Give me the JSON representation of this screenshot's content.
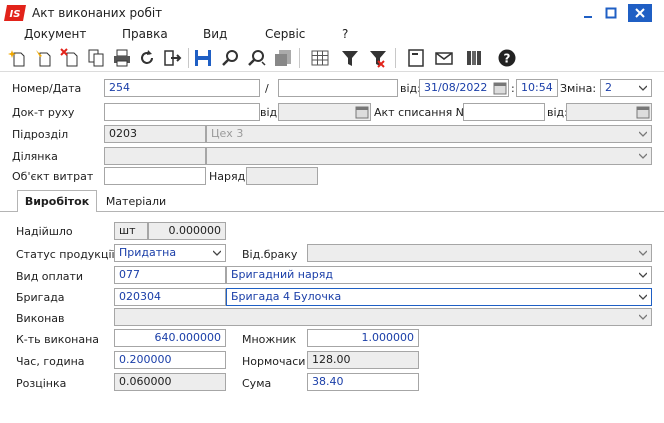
{
  "window": {
    "title": "Акт виконаних робіт",
    "logo_text": "IS"
  },
  "menu": [
    "Документ",
    "Правка",
    "Вид",
    "Сервіс",
    "?"
  ],
  "header": {
    "number_label": "Номер/Дата",
    "number_value": "254",
    "slash": "/",
    "suffix_value": "",
    "date_label": "від:",
    "date_value": "31/08/2022",
    "time_sep": ":",
    "time_value": "10:54",
    "shift_label": "Зміна:",
    "shift_value": "2",
    "movement_doc_label": "Док-т руху",
    "movement_doc_value": "",
    "movement_date_label": "від:",
    "movement_date_value": "",
    "writeoff_label": "Акт списання №",
    "writeoff_value": "",
    "writeoff_date_label": "від:",
    "writeoff_date_value": "",
    "division_label": "Підрозділ",
    "division_code": "0203",
    "division_name": "Цех 3",
    "section_label": "Ділянка",
    "section_code": "",
    "section_name": "",
    "cost_object_label": "Об'єкт витрат",
    "cost_object_value": "",
    "order_label": "Наряд:",
    "order_value": ""
  },
  "tabs": [
    "Виробіток",
    "Матеріали"
  ],
  "form": {
    "received_label": "Надійшло",
    "received_unit": "шт",
    "received_qty": "0.000000",
    "status_label": "Статус продукції",
    "status_value": "Придатна",
    "defect_label": "Від.браку",
    "defect_value": "",
    "payment_label": "Вид оплати",
    "payment_code": "077",
    "payment_name": "Бригадний наряд",
    "brigade_label": "Бригада",
    "brigade_code": "020304",
    "brigade_name": "Бригада 4 Булочка",
    "performer_label": "Виконав",
    "performer_value": "",
    "done_qty_label": "К-ть виконана",
    "done_qty_value": "640.000000",
    "multiplier_label": "Множник",
    "multiplier_value": "1.000000",
    "time_label": "Час, година",
    "time_value": "0.200000",
    "norm_hours_label": "Нормочаси",
    "norm_hours_value": "128.00",
    "rate_label": "Розцінка",
    "rate_value": "0.060000",
    "sum_label": "Сума",
    "sum_value": "38.40"
  },
  "colors": {
    "brand": "#e2231a",
    "value_blue": "#1a3ea8",
    "readonly_bg": "#ededed",
    "accent_blue": "#1f5fc4"
  }
}
